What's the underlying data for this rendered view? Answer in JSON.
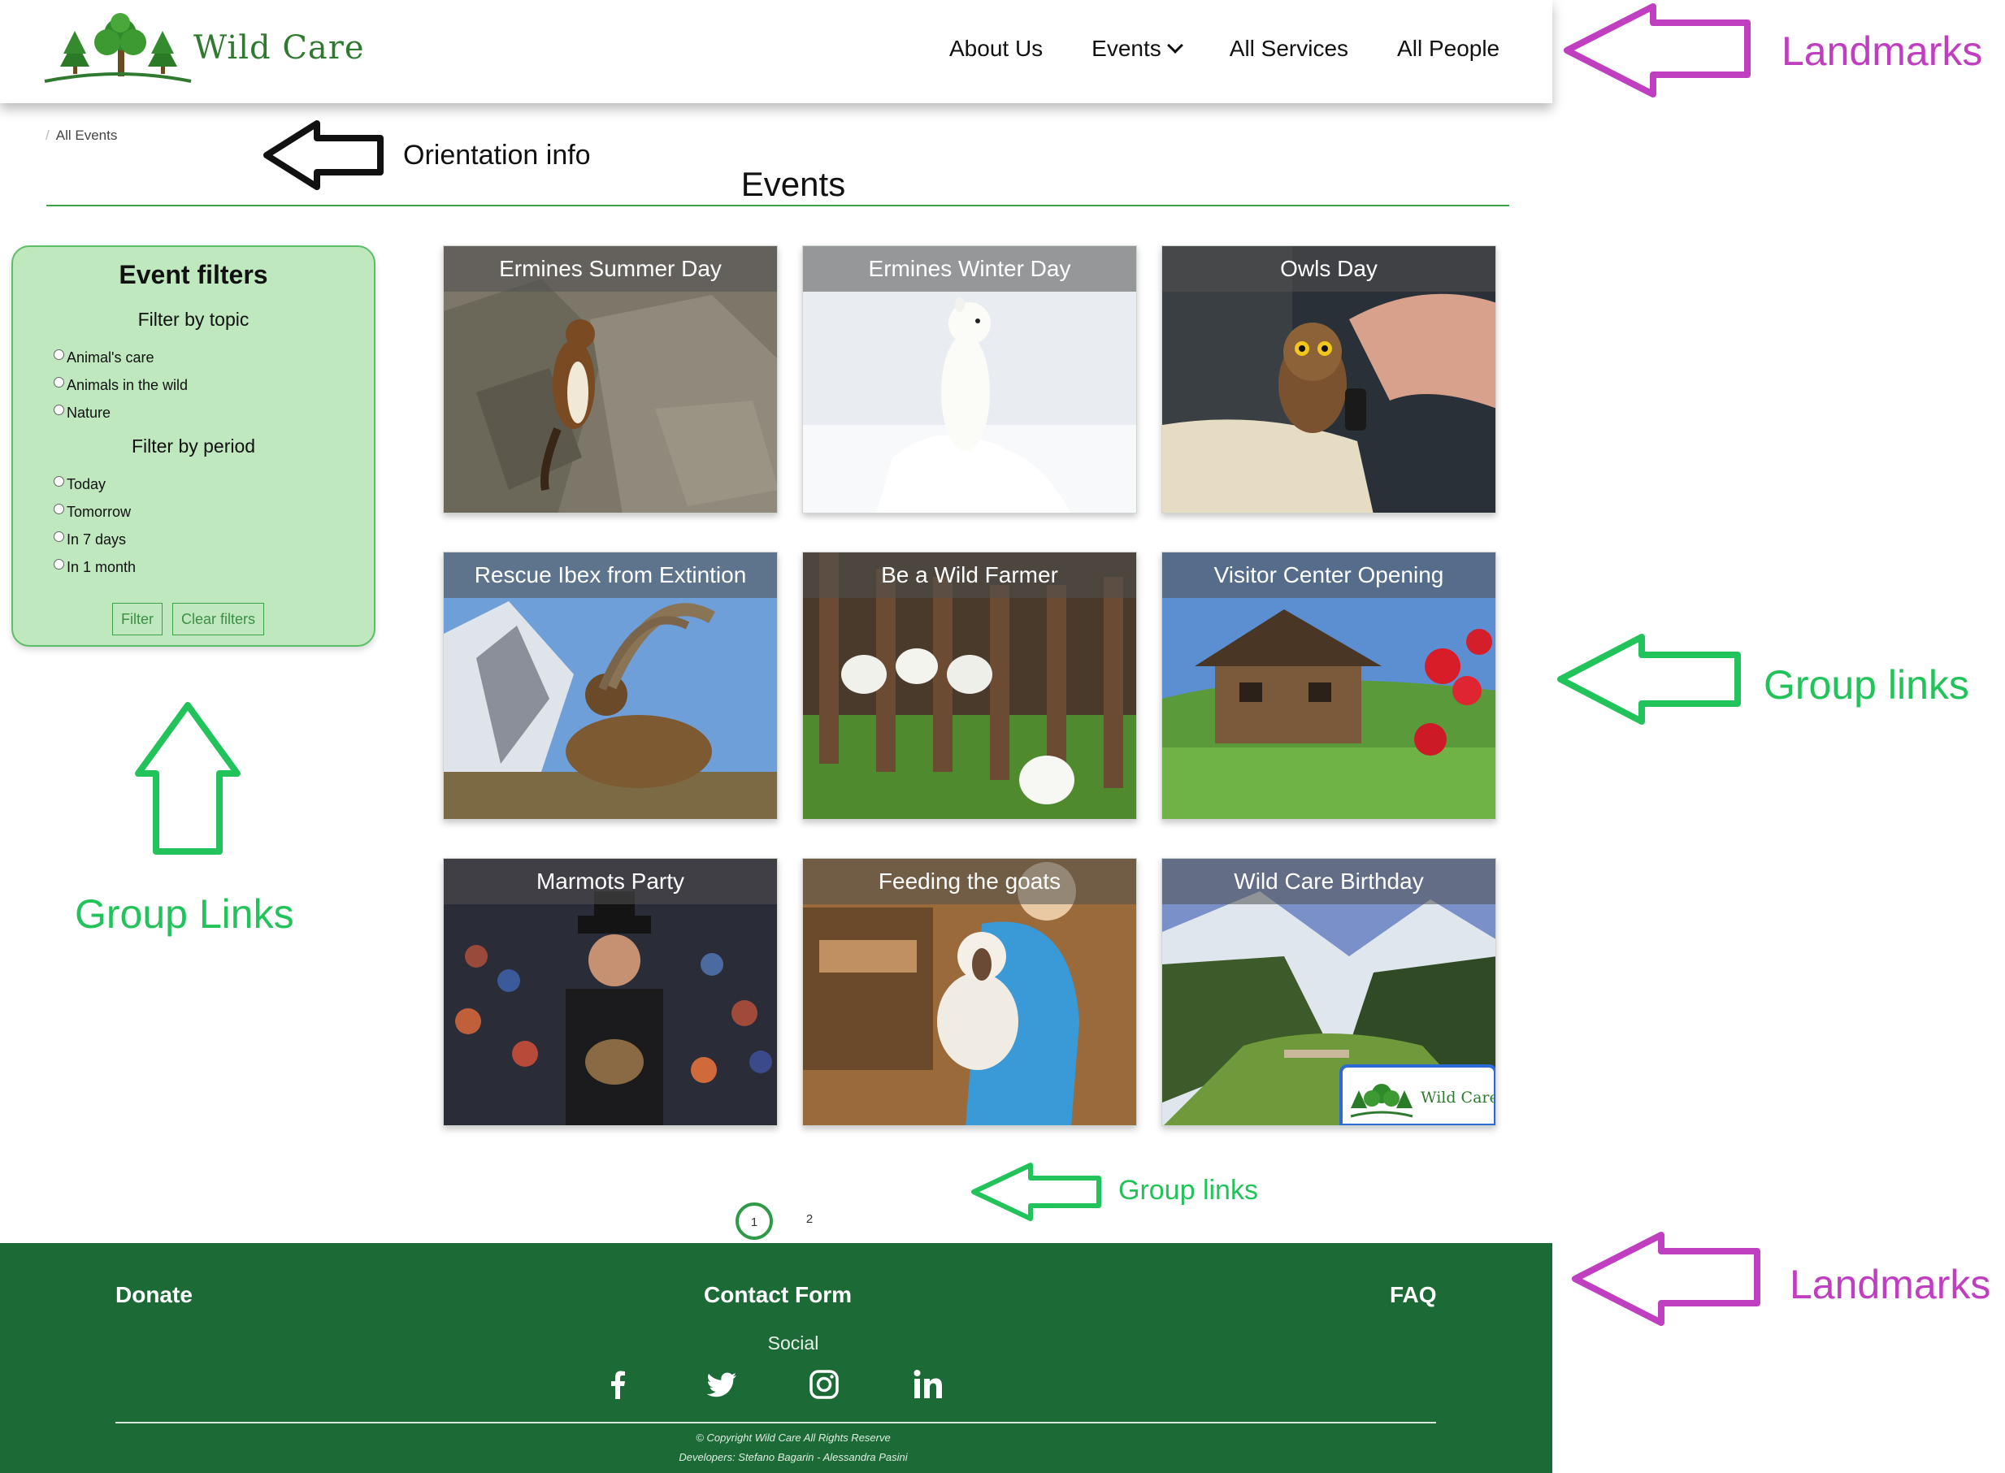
{
  "header": {
    "logo_text": "Wild Care",
    "nav": [
      {
        "label": "About Us"
      },
      {
        "label": "Events"
      },
      {
        "label": "All Services"
      },
      {
        "label": "All People"
      }
    ]
  },
  "breadcrumb": {
    "separator": "/",
    "current": "All Events"
  },
  "page_title": "Events",
  "filters": {
    "title": "Event filters",
    "topic_heading": "Filter by topic",
    "topics": [
      "Animal's care",
      "Animals in the wild",
      "Nature"
    ],
    "period_heading": "Filter by period",
    "periods": [
      "Today",
      "Tomorrow",
      "In 7 days",
      "In 1 month"
    ],
    "filter_button": "Filter",
    "clear_button": "Clear filters"
  },
  "events": [
    "Ermines Summer Day",
    "Ermines Winter Day",
    "Owls Day",
    "Rescue Ibex from Extintion",
    "Be a Wild Farmer",
    "Visitor Center Opening",
    "Marmots Party",
    "Feeding the goats",
    "Wild Care Birthday"
  ],
  "card_badge_text": "Wild Care",
  "pagination": {
    "pages": [
      "1",
      "2"
    ],
    "current": "1"
  },
  "footer": {
    "donate": "Donate",
    "contact": "Contact Form",
    "faq": "FAQ",
    "social_title": "Social",
    "social_icons": [
      "facebook-icon",
      "twitter-icon",
      "instagram-icon",
      "linkedin-icon"
    ],
    "copyright": "© Copyright Wild Care All Rights Reserve",
    "developers": "Developers: Stefano Bagarin - Alessandra Pasini"
  },
  "annotations": {
    "landmarks_top": "Landmarks",
    "orientation": "Orientation info",
    "group_links_right": "Group links",
    "group_links_left": "Group Links",
    "group_links_bottom": "Group links",
    "landmarks_bottom": "Landmarks"
  },
  "colors": {
    "brand_green": "#2f7a30",
    "footer_green": "#1c6a36",
    "filter_bg": "#bfe8bf",
    "annotation_magenta": "#c03ec0",
    "annotation_green": "#22c35a"
  }
}
